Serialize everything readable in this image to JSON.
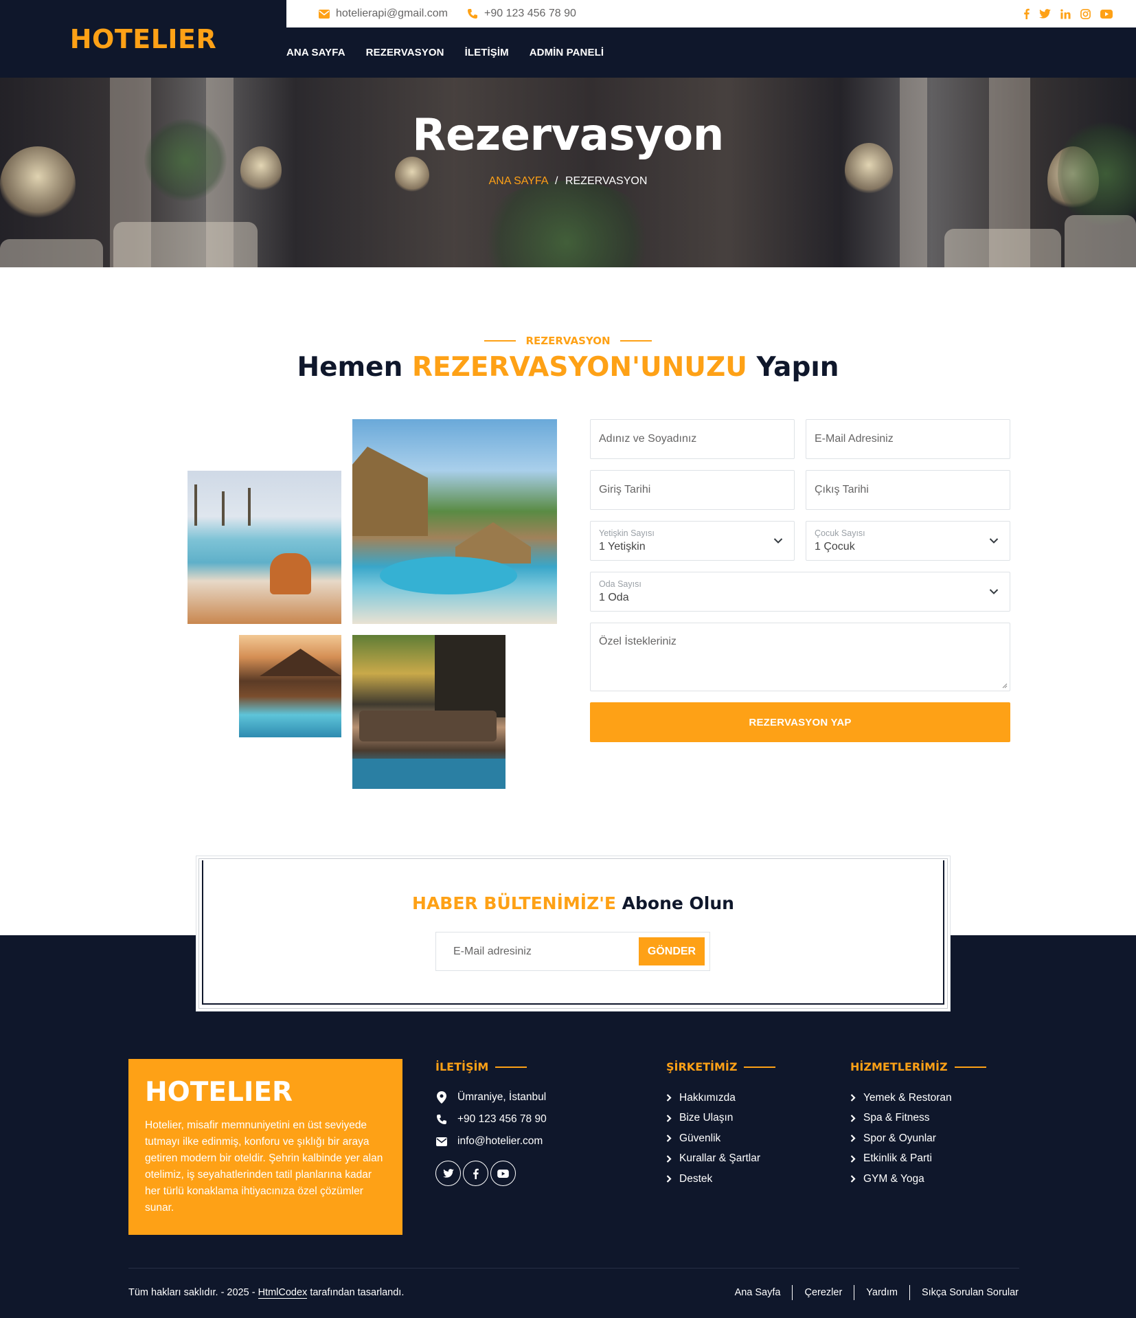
{
  "brand": {
    "name": "HOTELIER",
    "accent": "#fea116",
    "dark": "#0f172b"
  },
  "topbar": {
    "email": "hotelierapi@gmail.com",
    "phone": "+90 123 456 78 90",
    "socials": [
      "facebook-icon",
      "twitter-icon",
      "linkedin-icon",
      "instagram-icon",
      "youtube-icon"
    ]
  },
  "nav": {
    "items": [
      {
        "label": "ANA SAYFA"
      },
      {
        "label": "REZERVASYON"
      },
      {
        "label": "İLETİŞİM"
      },
      {
        "label": "ADMİN PANELİ"
      }
    ]
  },
  "hero": {
    "title": "Rezervasyon",
    "breadcrumb": {
      "home": "ANA SAYFA",
      "separator": "/",
      "current": "REZERVASYON"
    }
  },
  "booking": {
    "eyebrow": "REZERVASYON",
    "title_part1": "Hemen",
    "title_highlight": "REZERVASYON'UNUZU",
    "title_part2": "Yapın",
    "form": {
      "name_placeholder": "Adınız ve Soyadınız",
      "email_placeholder": "E-Mail Adresiniz",
      "checkin_placeholder": "Giriş Tarihi",
      "checkout_placeholder": "Çıkış Tarihi",
      "adults": {
        "label": "Yetişkin Sayısı",
        "value": "1 Yetişkin"
      },
      "children": {
        "label": "Çocuk Sayısı",
        "value": "1 Çocuk"
      },
      "rooms": {
        "label": "Oda Sayısı",
        "value": "1 Oda"
      },
      "requests_placeholder": "Özel İstekleriniz",
      "submit_label": "REZERVASYON YAP"
    }
  },
  "newsletter": {
    "title_highlight": "HABER BÜLTENİMİZ'E",
    "title_rest": "Abone Olun",
    "input_placeholder": "E-Mail adresiniz",
    "button_label": "GÖNDER"
  },
  "footer": {
    "about": {
      "brand": "HOTELIER",
      "text": "Hotelier, misafir memnuniyetini en üst seviyede tutmayı ilke edinmiş, konforu ve şıklığı bir araya getiren modern bir oteldir. Şehrin kalbinde yer alan otelimiz, iş seyahatlerinden tatil planlarına kadar her türlü konaklama ihtiyacınıza özel çözümler sunar."
    },
    "contact": {
      "title": "İLETİŞİM",
      "address": "Ümraniye, İstanbul",
      "phone": "+90 123 456 78 90",
      "email": "info@hotelier.com",
      "socials": [
        "twitter-icon",
        "facebook-icon",
        "youtube-icon"
      ]
    },
    "company": {
      "title": "ŞİRKETİMİZ",
      "links": [
        "Hakkımızda",
        "Bize Ulaşın",
        "Güvenlik",
        "Kurallar & Şartlar",
        "Destek"
      ]
    },
    "services": {
      "title": "HİZMETLERİMİZ",
      "links": [
        "Yemek & Restoran",
        "Spa & Fitness",
        "Spor & Oyunlar",
        "Etkinlik & Parti",
        "GYM & Yoga"
      ]
    },
    "bottom": {
      "copyright_pre": "Tüm hakları saklıdır. - 2025 -",
      "copyright_link": "HtmlCodex",
      "copyright_post": "tarafından tasarlandı.",
      "links": [
        "Ana Sayfa",
        "Çerezler",
        "Yardım",
        "Sıkça Sorulan Sorular"
      ]
    }
  }
}
